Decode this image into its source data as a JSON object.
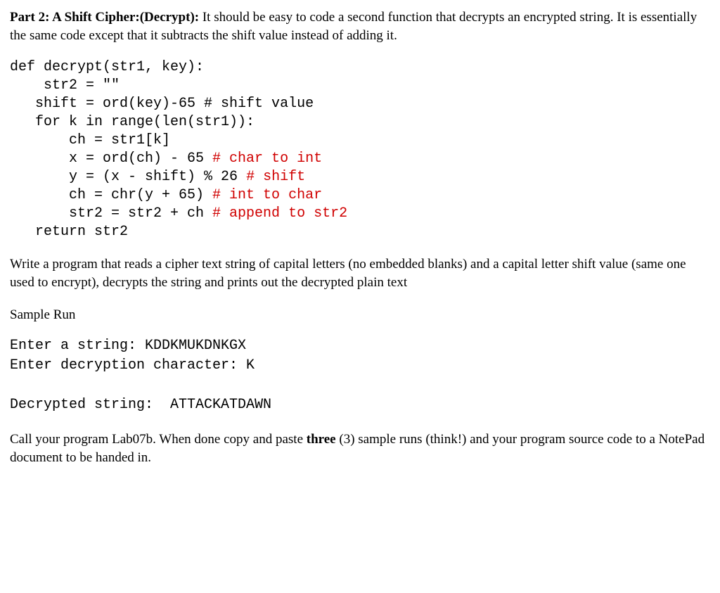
{
  "intro": {
    "heading": "Part 2: A Shift Cipher:(Decrypt):",
    "text": " It should be easy to code a second function that decrypts an encrypted string. It is essentially the same code except that it subtracts the shift value instead of adding it."
  },
  "code": {
    "l1": "def decrypt(str1, key):",
    "l2": "    str2 = \"\"",
    "l3": "   shift = ord(key)-65 # shift value",
    "l4": "   for k in range(len(str1)):",
    "l5": "       ch = str1[k]",
    "l6a": "       x = ord(ch) - 65 ",
    "l6b": "# char to int",
    "l7a": "       y = (x - shift) % 26 ",
    "l7b": "# shift",
    "l8a": "       ch = chr(y + 65) ",
    "l8b": "# int to char",
    "l9a": "       str2 = str2 + ch ",
    "l9b": "# append to str2",
    "l10": "   return str2"
  },
  "task": "Write a program that reads a cipher text string of capital letters (no embedded blanks) and a capital letter shift value (same one used to encrypt), decrypts the string and prints out the decrypted plain text",
  "sample_label": "Sample Run",
  "run": {
    "l1": "Enter a string: KDDKMUKDNKGX",
    "l2": "Enter decryption character: K",
    "l3": "Decrypted string:  ATTACKATDAWN"
  },
  "closing": {
    "a": "Call your program Lab07b. When done copy and paste ",
    "b": "three",
    "c": " (3) sample runs (think!) and your program source code to a NotePad document to be handed in."
  }
}
